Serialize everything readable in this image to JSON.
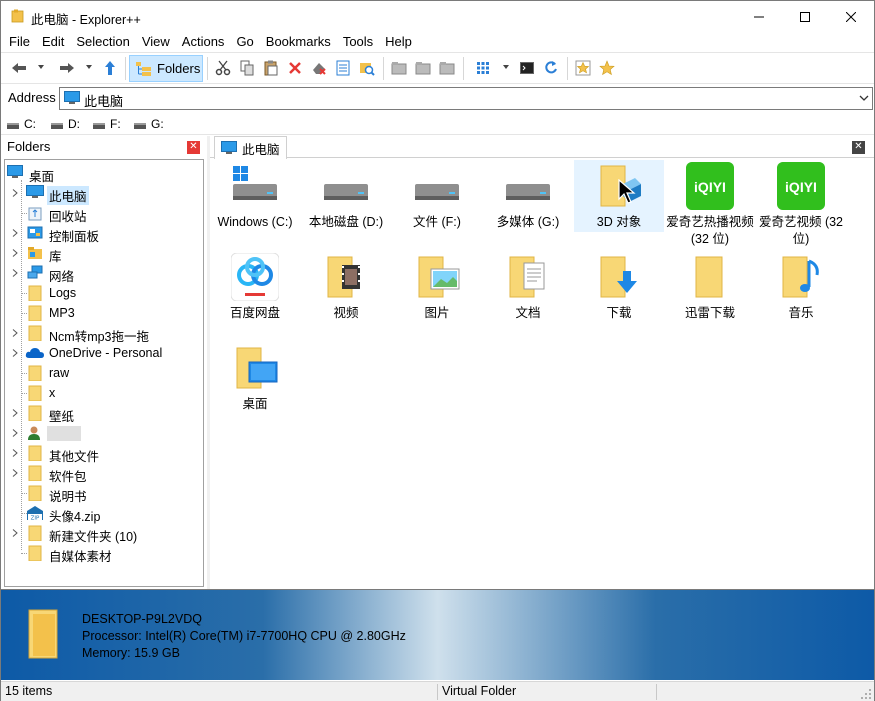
{
  "window": {
    "title": "此电脑 - Explorer++"
  },
  "menu": [
    "File",
    "Edit",
    "Selection",
    "View",
    "Actions",
    "Go",
    "Bookmarks",
    "Tools",
    "Help"
  ],
  "toolbar": {
    "folders_label": "Folders",
    "icons": [
      "back-icon",
      "forward-icon",
      "up-icon",
      "folders-icon",
      "cut-icon",
      "copy-icon",
      "paste-icon",
      "delete-icon",
      "delete-permanently-icon",
      "properties-icon",
      "search-icon",
      "new-folder-icon",
      "copy-to-icon",
      "move-to-icon",
      "views-icon",
      "command-prompt-icon",
      "refresh-icon",
      "bookmark-add-icon",
      "bookmarks-icon"
    ]
  },
  "address": {
    "label": "Address",
    "value": "此电脑"
  },
  "drives": [
    "C:",
    "D:",
    "F:",
    "G:"
  ],
  "folders_pane": {
    "title": "Folders",
    "tree": [
      {
        "label": "桌面",
        "level": 0,
        "icon": "desktop-icon",
        "expander": false
      },
      {
        "label": "此电脑",
        "level": 1,
        "icon": "computer-icon",
        "expander": true,
        "selected": true
      },
      {
        "label": "回收站",
        "level": 1,
        "icon": "recycle-bin-icon",
        "expander": false
      },
      {
        "label": "控制面板",
        "level": 1,
        "icon": "control-panel-icon",
        "expander": true
      },
      {
        "label": "库",
        "level": 1,
        "icon": "library-icon",
        "expander": true
      },
      {
        "label": "网络",
        "level": 1,
        "icon": "network-icon",
        "expander": true
      },
      {
        "label": "Logs",
        "level": 1,
        "icon": "folder-icon",
        "expander": false
      },
      {
        "label": "MP3",
        "level": 1,
        "icon": "folder-icon",
        "expander": false
      },
      {
        "label": "Ncm转mp3拖一拖",
        "level": 1,
        "icon": "folder-icon",
        "expander": true
      },
      {
        "label": "OneDrive - Personal",
        "level": 1,
        "icon": "onedrive-icon",
        "expander": true
      },
      {
        "label": "raw",
        "level": 1,
        "icon": "folder-icon",
        "expander": false
      },
      {
        "label": "x",
        "level": 1,
        "icon": "folder-icon",
        "expander": false
      },
      {
        "label": "壁纸",
        "level": 1,
        "icon": "folder-icon",
        "expander": true
      },
      {
        "label": "",
        "level": 1,
        "icon": "user-icon",
        "expander": true
      },
      {
        "label": "其他文件",
        "level": 1,
        "icon": "folder-icon",
        "expander": true
      },
      {
        "label": "软件包",
        "level": 1,
        "icon": "folder-icon",
        "expander": true
      },
      {
        "label": "说明书",
        "level": 1,
        "icon": "folder-icon",
        "expander": false
      },
      {
        "label": "头像4.zip",
        "level": 1,
        "icon": "zip-icon",
        "expander": false
      },
      {
        "label": "新建文件夹 (10)",
        "level": 1,
        "icon": "folder-icon",
        "expander": true
      },
      {
        "label": "自媒体素材",
        "level": 1,
        "icon": "folder-icon",
        "expander": false
      }
    ]
  },
  "tab": {
    "label": "此电脑"
  },
  "items": [
    {
      "label": "Windows (C:)",
      "icon": "windows-drive-icon"
    },
    {
      "label": "本地磁盘 (D:)",
      "icon": "hard-drive-icon"
    },
    {
      "label": "文件 (F:)",
      "icon": "hard-drive-icon"
    },
    {
      "label": "多媒体 (G:)",
      "icon": "hard-drive-icon"
    },
    {
      "label": "3D 对象",
      "icon": "3d-objects-folder-icon"
    },
    {
      "label": "爱奇艺热播视频 (32 位)",
      "icon": "iqiyi-icon"
    },
    {
      "label": "爱奇艺视频 (32 位)",
      "icon": "iqiyi-icon"
    },
    {
      "label": "百度网盘",
      "icon": "baidu-netdisk-icon"
    },
    {
      "label": "视频",
      "icon": "videos-folder-icon"
    },
    {
      "label": "图片",
      "icon": "pictures-folder-icon"
    },
    {
      "label": "文档",
      "icon": "documents-folder-icon"
    },
    {
      "label": "下载",
      "icon": "downloads-folder-icon"
    },
    {
      "label": "迅雷下载",
      "icon": "folder-icon"
    },
    {
      "label": "音乐",
      "icon": "music-folder-icon"
    },
    {
      "label": "桌面",
      "icon": "desktop-folder-icon"
    }
  ],
  "iqiyi_logo": "iQIYI",
  "info": {
    "computer_name": "DESKTOP-P9L2VDQ",
    "processor": "Processor: Intel(R) Core(TM) i7-7700HQ CPU @ 2.80GHz",
    "memory": "Memory: 15.9 GB"
  },
  "status": {
    "count": "15 items",
    "location": "Virtual Folder"
  },
  "colors": {
    "accent": "#cce8ff",
    "selection_border": "#99d1ff",
    "folder": "#f8d775",
    "info_panel": "#0d5aa7",
    "iqiyi": "#00be06"
  }
}
